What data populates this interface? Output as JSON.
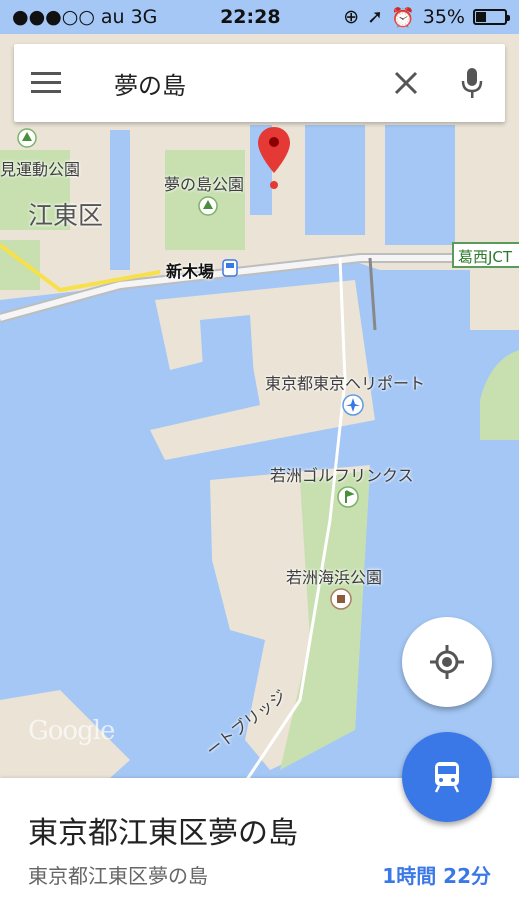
{
  "status_bar": {
    "signal": "●●●○○",
    "carrier": "au",
    "network": "3G",
    "time": "22:28",
    "battery": "35%"
  },
  "search": {
    "query": "夢の島"
  },
  "map": {
    "labels": {
      "ward": "江東区",
      "park_partial": "見運動公園",
      "yumenoshima_park": "夢の島公園",
      "station": "新木場",
      "heliport": "東京都東京ヘリポート",
      "golf": "若洲ゴルフリンクス",
      "seaside_park": "若洲海浜公園",
      "bridge": "ートブリッジ",
      "jct": "葛西JCT"
    },
    "attribution": "Google"
  },
  "place_sheet": {
    "title": "東京都江東区夢の島",
    "address": "東京都江東区夢の島",
    "eta": "1時間 22分"
  },
  "colors": {
    "water": "#a4c7f5",
    "land": "#eae3d6",
    "park": "#c8dfb0",
    "accent": "#3b78e7",
    "marker": "#e53935"
  }
}
